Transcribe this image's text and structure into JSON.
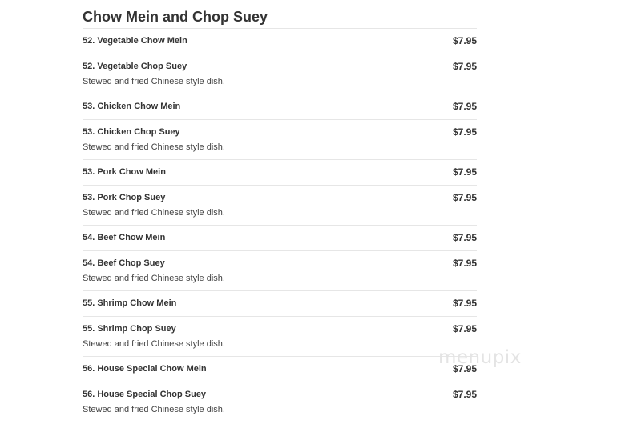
{
  "section": {
    "title": "Chow Mein and Chop Suey"
  },
  "items": [
    {
      "name": "52. Vegetable Chow Mein",
      "price": "$7.95",
      "description": ""
    },
    {
      "name": "52. Vegetable Chop Suey",
      "price": "$7.95",
      "description": "Stewed and fried Chinese style dish."
    },
    {
      "name": "53. Chicken Chow Mein",
      "price": "$7.95",
      "description": ""
    },
    {
      "name": "53. Chicken Chop Suey",
      "price": "$7.95",
      "description": "Stewed and fried Chinese style dish."
    },
    {
      "name": "53. Pork Chow Mein",
      "price": "$7.95",
      "description": ""
    },
    {
      "name": "53. Pork Chop Suey",
      "price": "$7.95",
      "description": "Stewed and fried Chinese style dish."
    },
    {
      "name": "54. Beef Chow Mein",
      "price": "$7.95",
      "description": ""
    },
    {
      "name": "54. Beef Chop Suey",
      "price": "$7.95",
      "description": "Stewed and fried Chinese style dish."
    },
    {
      "name": "55. Shrimp Chow Mein",
      "price": "$7.95",
      "description": ""
    },
    {
      "name": "55. Shrimp Chop Suey",
      "price": "$7.95",
      "description": "Stewed and fried Chinese style dish."
    },
    {
      "name": "56. House Special Chow Mein",
      "price": "$7.95",
      "description": ""
    },
    {
      "name": "56. House Special Chop Suey",
      "price": "$7.95",
      "description": "Stewed and fried Chinese style dish."
    }
  ],
  "watermark": {
    "text": "menupix"
  }
}
